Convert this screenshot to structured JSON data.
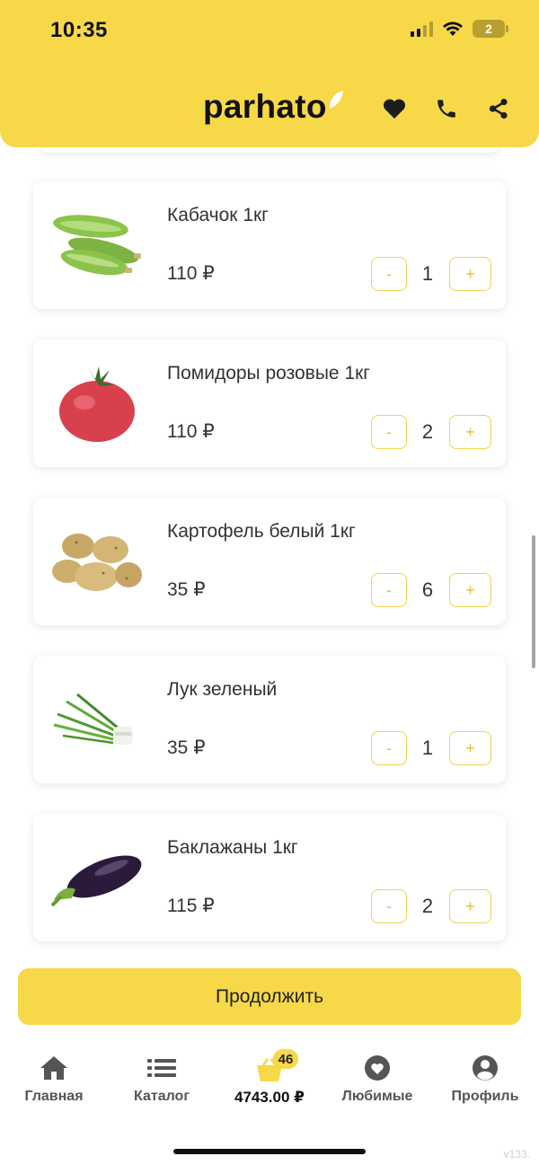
{
  "status_bar": {
    "time": "10:35",
    "battery": "2"
  },
  "header": {
    "logo": "parhato"
  },
  "products": [
    {
      "name": "Кабачок 1кг",
      "price": "110 ₽",
      "qty": "1",
      "image": "zucchini"
    },
    {
      "name": "Помидоры розовые 1кг",
      "price": "110 ₽",
      "qty": "2",
      "image": "tomato"
    },
    {
      "name": "Картофель белый 1кг",
      "price": "35 ₽",
      "qty": "6",
      "image": "potato"
    },
    {
      "name": "Лук зеленый",
      "price": "35 ₽",
      "qty": "1",
      "image": "green-onion"
    },
    {
      "name": "Баклажаны 1кг",
      "price": "115 ₽",
      "qty": "2",
      "image": "eggplant"
    }
  ],
  "qty_controls": {
    "minus": "-",
    "plus": "+"
  },
  "continue_label": "Продолжить",
  "nav": {
    "home": "Главная",
    "catalog": "Каталог",
    "cart_total": "4743.00 ₽",
    "cart_count": "46",
    "favorites": "Любимые",
    "profile": "Профиль"
  },
  "version": "v133.",
  "colors": {
    "accent": "#F7D849",
    "button_border": "#F2D34A"
  }
}
